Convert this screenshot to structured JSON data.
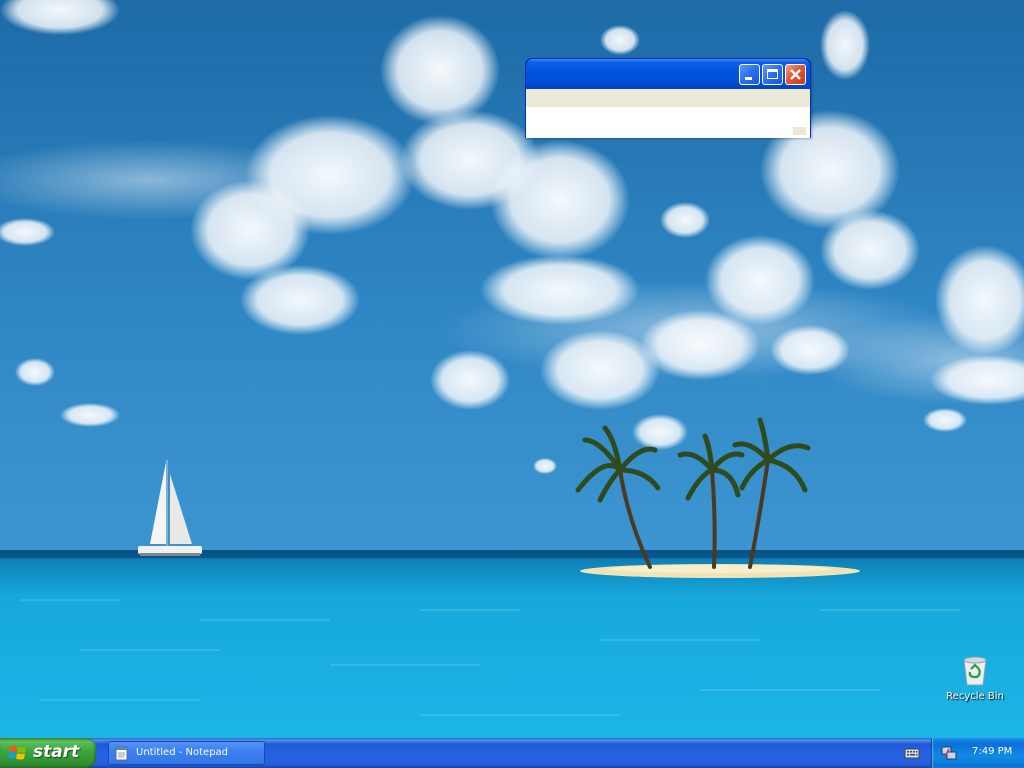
{
  "desktop": {
    "wallpaper": "tropical-island-beach",
    "icons": [
      {
        "label": "Recycle Bin",
        "icon": "recycle-bin-icon"
      }
    ]
  },
  "window": {
    "app": "Notepad",
    "title": "",
    "buttons": [
      "minimize-button",
      "maximize-button",
      "close-button"
    ],
    "content": ""
  },
  "taskbar": {
    "start_label": "start",
    "tasks": [
      {
        "label": "Untitled - Notepad",
        "icon": "notepad-icon"
      }
    ],
    "tray": {
      "icons": [
        "keyboard-language-icon",
        "network-icon"
      ],
      "clock": "7:49 PM"
    }
  },
  "colors": {
    "titlebar": "#0054e3",
    "taskbar": "#245edb",
    "start_button": "#3fa83f",
    "tray": "#0f8be4",
    "close_button": "#e05a35"
  }
}
